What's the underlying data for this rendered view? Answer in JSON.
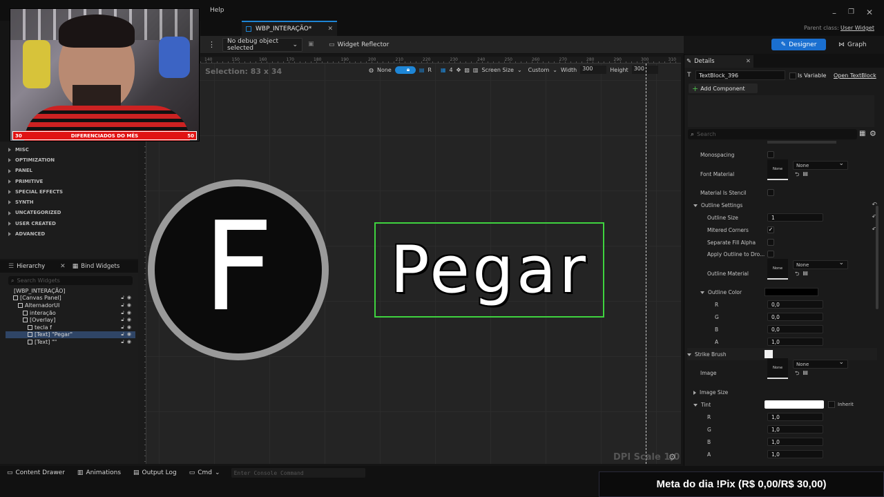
{
  "window": {
    "menu_help": "Help",
    "parent_class_label": "Parent class:",
    "parent_class_value": "User Widget"
  },
  "doc_tab": {
    "title": "WBP_INTERAÇÃO*"
  },
  "toolbar": {
    "debug_object": "No debug object selected",
    "widget_reflector": "Widget Reflector",
    "designer": "Designer",
    "graph": "Graph"
  },
  "canvas_toolbar": {
    "selection": "Selection: 83 x 34",
    "none_label": "None",
    "grid_count": "4",
    "screen_size": "Screen Size",
    "custom": "Custom",
    "width_label": "Width",
    "width_value": "300",
    "height_label": "Height",
    "height_value": "300"
  },
  "ruler_ticks": [
    "140",
    "150",
    "160",
    "170",
    "180",
    "190",
    "200",
    "210",
    "220",
    "230",
    "240",
    "250",
    "260",
    "270",
    "280",
    "290",
    "300",
    "310"
  ],
  "canvas": {
    "circle_letter": "F",
    "text_block": "Pegar",
    "dpi_scale": "DPI Scale 1,0"
  },
  "webcam": {
    "banner_left": "30",
    "banner_text": "DIFERENCIADOS DO MÊS",
    "banner_right": "50"
  },
  "palette_categories": [
    "MISC",
    "OPTIMIZATION",
    "PANEL",
    "PRIMITIVE",
    "SPECIAL EFFECTS",
    "SYNTH",
    "UNCATEGORIZED",
    "USER CREATED",
    "ADVANCED"
  ],
  "hierarchy": {
    "tab_hierarchy": "Hierarchy",
    "tab_bind": "Bind Widgets",
    "search_placeholder": "Search Widgets",
    "rows": [
      {
        "label": "[WBP_INTERAÇÃO]",
        "indent": 0
      },
      {
        "label": "[Canvas Panel]",
        "indent": 1
      },
      {
        "label": "AlternadorUI",
        "indent": 2
      },
      {
        "label": "interação",
        "indent": 3
      },
      {
        "label": "[Overlay]",
        "indent": 3
      },
      {
        "label": "tecla f",
        "indent": 4
      },
      {
        "label": "[Text] \"Pegar\"",
        "indent": 4
      },
      {
        "label": "[Text] \"\"",
        "indent": 4
      }
    ]
  },
  "details": {
    "tab": "Details",
    "widget_name": "TextBlock_396",
    "is_variable": "Is Variable",
    "open_textblock": "Open TextBlock",
    "add_component": "Add Component",
    "search_placeholder": "Search",
    "monospacing": "Monospacing",
    "font_material": "Font Material",
    "none": "None",
    "material_is_stencil": "Material Is Stencil",
    "outline_settings": "Outline Settings",
    "outline_size": "Outline Size",
    "outline_size_value": "1",
    "mitered_corners": "Mitered Corners",
    "separate_fill_alpha": "Separate Fill Alpha",
    "apply_outline": "Apply Outline to Dro...",
    "outline_material": "Outline Material",
    "outline_color": "Outline Color",
    "r": "R",
    "g": "G",
    "b": "B",
    "a": "A",
    "outline_r": "0,0",
    "outline_g": "0,0",
    "outline_b": "0,0",
    "outline_a": "1,0",
    "strike_brush": "Strike Brush",
    "image": "Image",
    "image_size": "Image Size",
    "tint": "Tint",
    "inherit": "Inherit",
    "tint_r": "1,0",
    "tint_g": "1,0",
    "tint_b": "1,0",
    "tint_a": "1,0"
  },
  "status_bar": {
    "content_drawer": "Content Drawer",
    "animations": "Animations",
    "output_log": "Output Log",
    "cmd": "Cmd",
    "console_placeholder": "Enter Console Command"
  },
  "overlay": {
    "meta": "Meta do dia !Pix (R$ 0,00/R$ 30,00)"
  },
  "colors": {
    "accent": "#1e86d6",
    "selection_green": "#3fd43f",
    "designer_btn": "#1a6fd0"
  }
}
